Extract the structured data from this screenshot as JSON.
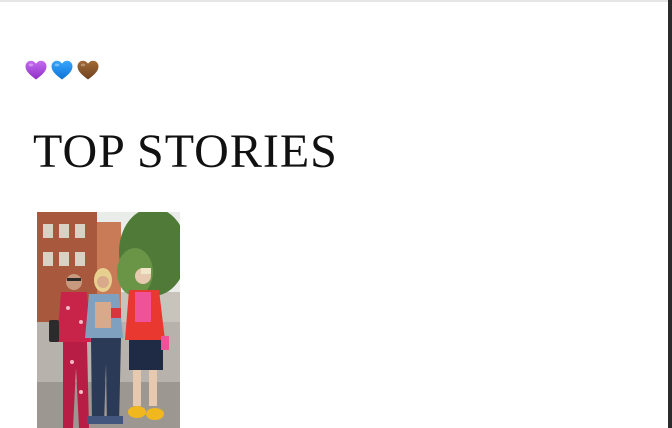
{
  "header": {
    "emoji_hearts": [
      {
        "icon": "purple-heart-icon",
        "color": "#a94bd9"
      },
      {
        "icon": "blue-heart-icon",
        "color": "#1f8ff0"
      },
      {
        "icon": "brown-heart-icon",
        "color": "#8a5a2c"
      }
    ]
  },
  "main": {
    "section_title": "TOP STORIES",
    "stories": [
      {
        "image": "street-style-photo"
      }
    ]
  }
}
